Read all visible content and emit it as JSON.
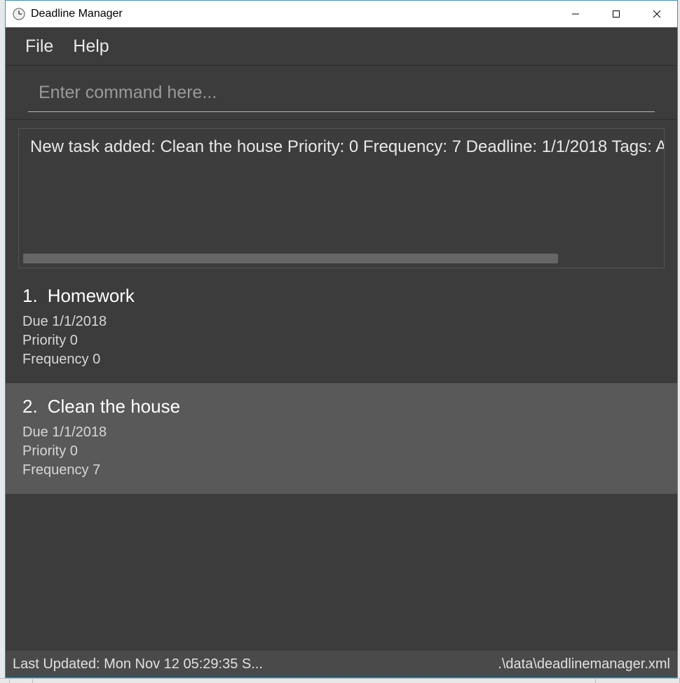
{
  "window": {
    "title": "Deadline Manager"
  },
  "menu": {
    "file": "File",
    "help": "Help"
  },
  "command": {
    "placeholder": "Enter command here..."
  },
  "output": {
    "message": "New task added: Clean the house Priority: 0 Frequency: 7 Deadline: 1/1/2018 Tags:  A"
  },
  "tasks": [
    {
      "number": "1.",
      "name": "Homework",
      "due_label": "Due",
      "due": "1/1/2018",
      "priority_label": "Priority",
      "priority": "0",
      "frequency_label": "Frequency",
      "frequency": "0"
    },
    {
      "number": "2.",
      "name": "Clean the house",
      "due_label": "Due",
      "due": "1/1/2018",
      "priority_label": "Priority",
      "priority": "0",
      "frequency_label": "Frequency",
      "frequency": "7"
    }
  ],
  "status": {
    "last_updated": "Last Updated: Mon Nov 12 05:29:35 S...",
    "file_path": ".\\data\\deadlinemanager.xml"
  }
}
